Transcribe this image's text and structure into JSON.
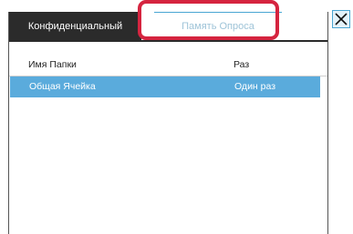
{
  "tabs": {
    "active_label": "Конфиденциальный",
    "inactive_label": "Память Опроса"
  },
  "table": {
    "headers": {
      "name": "Имя Папки",
      "times": "Раз"
    },
    "rows": [
      {
        "name": "Общая Ячейка",
        "times": "Один раз",
        "selected": true
      }
    ]
  },
  "icons": {
    "close": "close-icon"
  },
  "colors": {
    "active_tab_bg": "#2b2b2b",
    "inactive_tab_text": "#9fc4d8",
    "highlight": "#d5243f",
    "selected_row": "#5aabdc",
    "close_accent": "#4aa6d3"
  }
}
